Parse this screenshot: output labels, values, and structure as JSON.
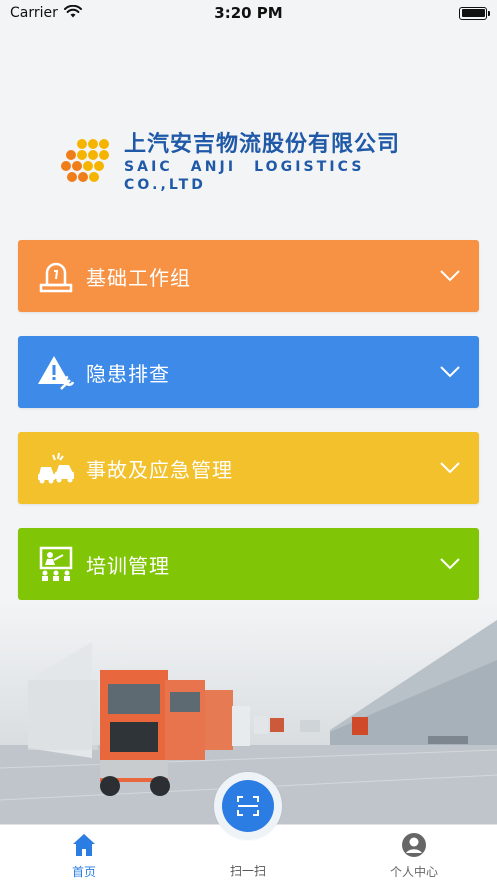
{
  "status_bar": {
    "carrier": "Carrier",
    "time": "3:20 PM"
  },
  "logo": {
    "name_cn": "上汽安吉物流股份有限公司",
    "name_en": "SAIC  ANJI  LOGISTICS   CO.,LTD",
    "brand_color": "#1f59a8"
  },
  "menu": [
    {
      "label": "基础工作组",
      "icon": "warning-light-icon",
      "color": "#f79244"
    },
    {
      "label": "隐患排查",
      "icon": "hazard-wrench-icon",
      "color": "#3e8ae8"
    },
    {
      "label": "事故及应急管理",
      "icon": "car-accident-icon",
      "color": "#f2c12c"
    },
    {
      "label": "培训管理",
      "icon": "training-board-icon",
      "color": "#80c606"
    }
  ],
  "tabbar": {
    "home_label": "首页",
    "scan_label": "扫一扫",
    "profile_label": "个人中心",
    "active_color": "#2b7de3",
    "inactive_color": "#666666"
  }
}
